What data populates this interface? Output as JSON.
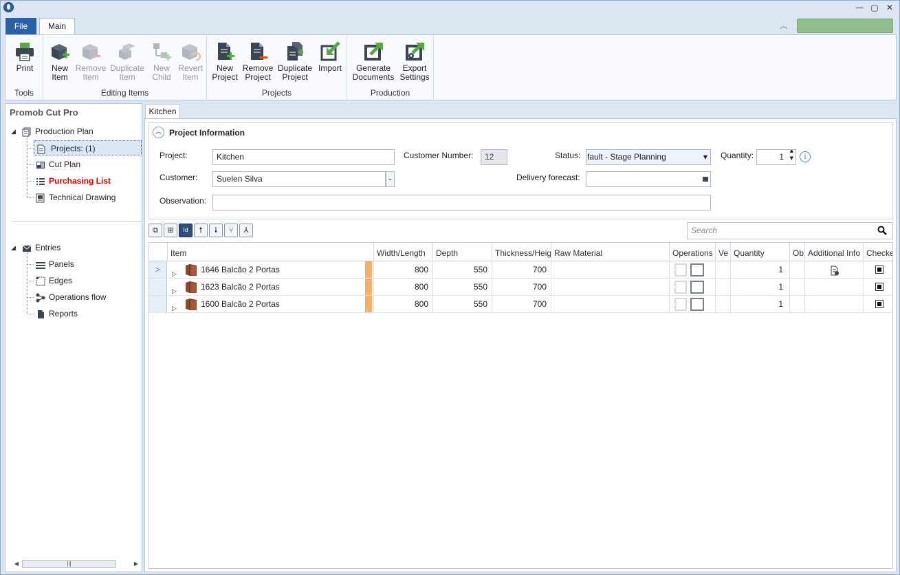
{
  "window": {
    "title": "",
    "controls": {
      "minimize": "—",
      "maximize": "▢",
      "close": "✕"
    }
  },
  "ribbon_tabs": {
    "file": "File",
    "main": "Main"
  },
  "ribbon": {
    "groups": [
      {
        "label": "Tools",
        "buttons": [
          {
            "label": "Print",
            "icon": "printer-icon",
            "enabled": true
          }
        ]
      },
      {
        "label": "Editing Items",
        "buttons": [
          {
            "label": "New Item",
            "icon": "new-item-icon",
            "enabled": true
          },
          {
            "label": "Remove Item",
            "icon": "remove-item-icon",
            "enabled": false
          },
          {
            "label": "Duplicate Item",
            "icon": "duplicate-item-icon",
            "enabled": false
          },
          {
            "label": "New Child",
            "icon": "new-child-icon",
            "enabled": false
          },
          {
            "label": "Revert Item",
            "icon": "revert-item-icon",
            "enabled": false
          }
        ]
      },
      {
        "label": "Projects",
        "buttons": [
          {
            "label": "New Project",
            "icon": "new-project-icon",
            "enabled": true
          },
          {
            "label": "Remove Project",
            "icon": "remove-project-icon",
            "enabled": true
          },
          {
            "label": "Duplicate Project",
            "icon": "duplicate-project-icon",
            "enabled": true
          },
          {
            "label": "Import",
            "icon": "import-icon",
            "enabled": true
          }
        ]
      },
      {
        "label": "Production",
        "buttons": [
          {
            "label": "Generate Documents",
            "icon": "generate-documents-icon",
            "enabled": true
          },
          {
            "label": "Export Settings",
            "icon": "export-settings-icon",
            "enabled": true
          }
        ]
      }
    ]
  },
  "sidebar": {
    "title": "Promob Cut Pro",
    "production_plan": {
      "label": "Production Plan",
      "items": [
        {
          "label": "Projects: (1)",
          "icon": "projects-icon",
          "selected": true
        },
        {
          "label": "Cut Plan",
          "icon": "cut-plan-icon"
        },
        {
          "label": "Purchasing List",
          "icon": "list-icon",
          "highlight": "#d40000"
        },
        {
          "label": "Technical Drawing",
          "icon": "technical-drawing-icon"
        }
      ]
    },
    "entries": {
      "label": "Entries",
      "items": [
        {
          "label": "Panels",
          "icon": "panels-icon"
        },
        {
          "label": "Edges",
          "icon": "edges-icon"
        },
        {
          "label": "Operations flow",
          "icon": "operations-flow-icon"
        },
        {
          "label": "Reports",
          "icon": "reports-icon"
        }
      ]
    }
  },
  "document_tab": "Kitchen",
  "project_info": {
    "header": "Project Information",
    "project_label": "Project:",
    "project_value": "Kitchen",
    "customer_number_label": "Customer Number:",
    "customer_number_value": "12",
    "status_label": "Status:",
    "status_value": "fault - Stage Planning",
    "quantity_label": "Quantity:",
    "quantity_value": "1",
    "customer_label": "Customer:",
    "customer_value": "Suelen Silva",
    "delivery_label": "Delivery forecast:",
    "delivery_value": "",
    "observation_label": "Observation:",
    "observation_value": ""
  },
  "search": {
    "placeholder": "Search"
  },
  "grid": {
    "columns": [
      "Item",
      "Width/Length",
      "Depth",
      "Thickness/Heig",
      "Raw Material",
      "Operations",
      "Ve",
      "Quantity",
      "Ob",
      "Additional Info",
      "Checke"
    ],
    "rows": [
      {
        "item": "1646  Balcão 2 Portas",
        "width": "800",
        "depth": "550",
        "thickness": "700",
        "raw_material": "",
        "quantity": "1",
        "has_info": true,
        "current": true
      },
      {
        "item": "1623  Balcão 2 Portas",
        "width": "800",
        "depth": "550",
        "thickness": "700",
        "raw_material": "",
        "quantity": "1",
        "has_info": false,
        "current": false
      },
      {
        "item": "1600  Balcão 2 Portas",
        "width": "800",
        "depth": "550",
        "thickness": "700",
        "raw_material": "",
        "quantity": "1",
        "has_info": false,
        "current": false
      }
    ]
  },
  "colors": {
    "accent": "#2c5fa6",
    "green": "#5aa844",
    "flag": "#f7b06a",
    "purchasing": "#d40000"
  }
}
